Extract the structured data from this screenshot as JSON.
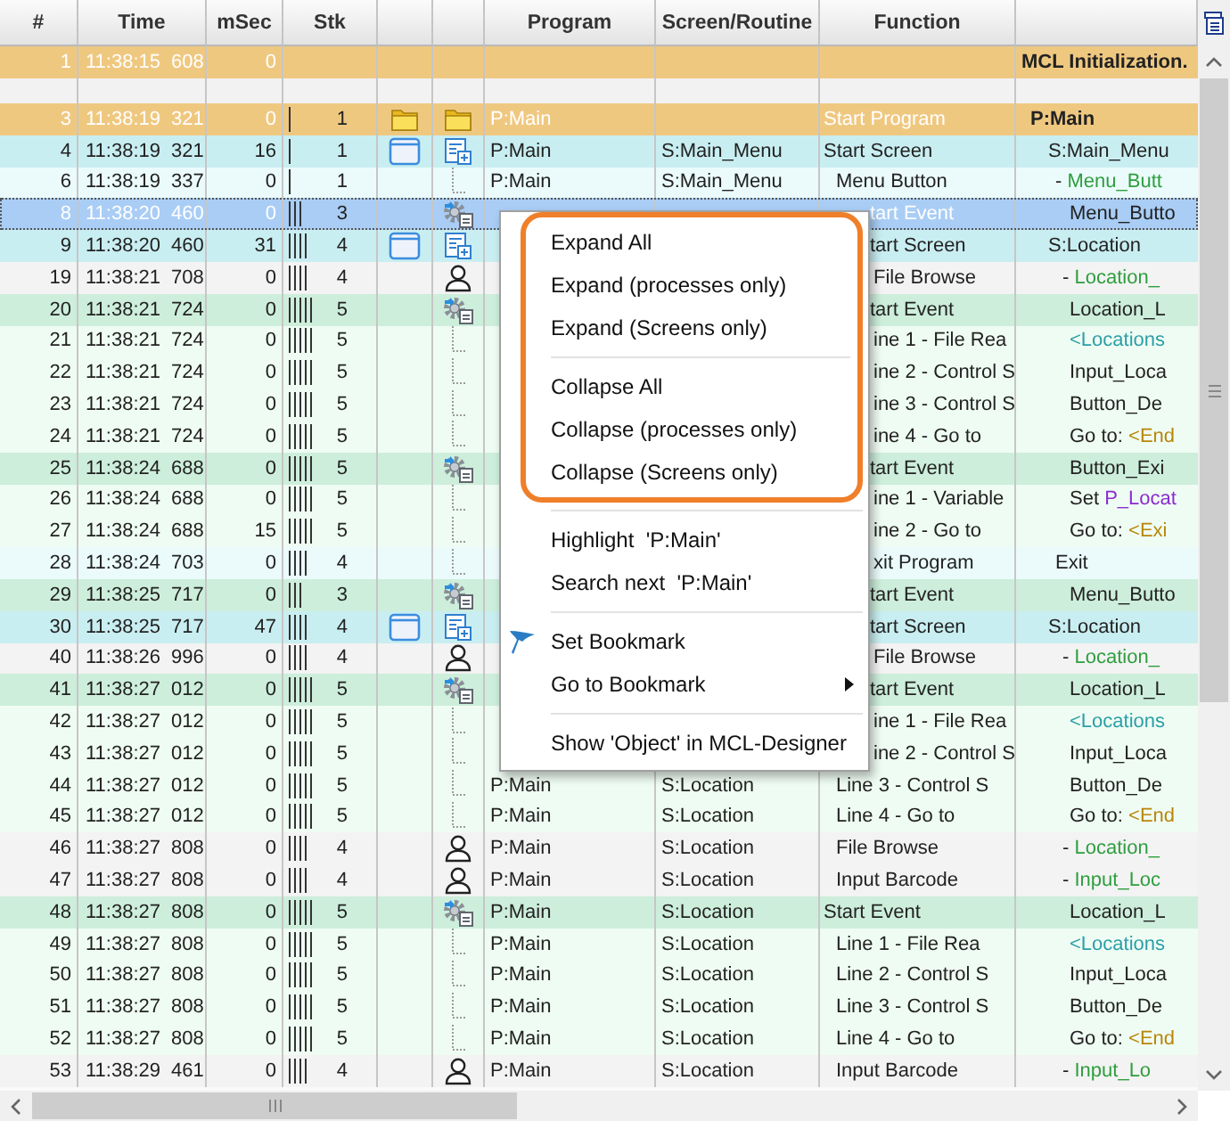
{
  "columns": [
    "#",
    "Time",
    "mSec",
    "Stk",
    "Program",
    "Screen/Routine",
    "Function"
  ],
  "rows": [
    {
      "kind": "init",
      "selected": false,
      "num": "1",
      "time": "11:38:15 608",
      "msec": "0",
      "detail": [
        {
          "text": "MCL Initialization."
        }
      ]
    },
    {
      "kind": "blank",
      "selected": false
    },
    {
      "kind": "program",
      "selected": false,
      "num": "3",
      "time": "11:38:19 321",
      "msec": "0",
      "stk": "1",
      "program": "P:Main",
      "function": "Start Program",
      "detail": [
        {
          "text": "P:Main"
        }
      ]
    },
    {
      "kind": "screen",
      "selected": false,
      "num": "4",
      "time": "11:38:19 321",
      "msec": "16",
      "stk": "1",
      "program": "P:Main",
      "screen": "S:Main_Menu",
      "function": "Start Screen",
      "detail": [
        {
          "text": "S:Main_Menu"
        }
      ]
    },
    {
      "kind": "screen_item",
      "selected": false,
      "num": "6",
      "time": "11:38:19 337",
      "msec": "0",
      "stk": "1",
      "program": "P:Main",
      "screen": "S:Main_Menu",
      "function": "Menu Button",
      "detail": [
        {
          "text": "- "
        },
        {
          "text": "Menu_Butt",
          "kind": "control"
        }
      ]
    },
    {
      "kind": "event",
      "selected": true,
      "num": "8",
      "time": "11:38:20 460",
      "msec": "0",
      "stk": "3",
      "function": "tart Event",
      "detail": [
        {
          "text": "Menu_Butto"
        }
      ]
    },
    {
      "kind": "screen",
      "selected": false,
      "num": "9",
      "time": "11:38:20 460",
      "msec": "31",
      "stk": "4",
      "function": "tart Screen",
      "detail": [
        {
          "text": "S:Location"
        }
      ]
    },
    {
      "kind": "user",
      "selected": false,
      "num": "19",
      "time": "11:38:21 708",
      "msec": "0",
      "stk": "4",
      "function": "File Browse",
      "detail": [
        {
          "text": "- "
        },
        {
          "text": "Location_",
          "kind": "control"
        }
      ]
    },
    {
      "kind": "event",
      "selected": false,
      "num": "20",
      "time": "11:38:21 724",
      "msec": "0",
      "stk": "5",
      "function": "tart Event",
      "detail": [
        {
          "text": "Location_L"
        }
      ]
    },
    {
      "kind": "line",
      "selected": false,
      "num": "21",
      "time": "11:38:21 724",
      "msec": "0",
      "stk": "5",
      "function": "ine 1 - File Rea",
      "detail": [
        {
          "text": "<Locations",
          "kind": "list"
        }
      ]
    },
    {
      "kind": "line",
      "selected": false,
      "num": "22",
      "time": "11:38:21 724",
      "msec": "0",
      "stk": "5",
      "function": "ine 2 - Control S",
      "detail": [
        {
          "text": "Input_Loca"
        }
      ]
    },
    {
      "kind": "line",
      "selected": false,
      "num": "23",
      "time": "11:38:21 724",
      "msec": "0",
      "stk": "5",
      "function": "ine 3 - Control S",
      "detail": [
        {
          "text": "Button_De"
        }
      ]
    },
    {
      "kind": "line",
      "selected": false,
      "num": "24",
      "time": "11:38:21 724",
      "msec": "0",
      "stk": "5",
      "function": "ine 4 - Go to",
      "detail": [
        {
          "text": "Go to: "
        },
        {
          "text": "<End",
          "kind": "label"
        }
      ]
    },
    {
      "kind": "event",
      "selected": false,
      "num": "25",
      "time": "11:38:24 688",
      "msec": "0",
      "stk": "5",
      "function": "tart Event",
      "detail": [
        {
          "text": "Button_Exi"
        }
      ]
    },
    {
      "kind": "line",
      "selected": false,
      "num": "26",
      "time": "11:38:24 688",
      "msec": "0",
      "stk": "5",
      "function": "ine 1 - Variable",
      "detail": [
        {
          "text": "Set "
        },
        {
          "text": "P_Locat",
          "kind": "variable"
        }
      ]
    },
    {
      "kind": "line",
      "selected": false,
      "num": "27",
      "time": "11:38:24 688",
      "msec": "15",
      "stk": "5",
      "function": "ine 2 - Go to",
      "detail": [
        {
          "text": "Go to: "
        },
        {
          "text": "<Exi",
          "kind": "label"
        }
      ]
    },
    {
      "kind": "screen_item",
      "selected": false,
      "num": "28",
      "time": "11:38:24 703",
      "msec": "0",
      "stk": "4",
      "function": "xit Program",
      "detail": [
        {
          "text": "Exit"
        }
      ]
    },
    {
      "kind": "event",
      "selected": false,
      "num": "29",
      "time": "11:38:25 717",
      "msec": "0",
      "stk": "3",
      "function": "tart Event",
      "detail": [
        {
          "text": "Menu_Butto"
        }
      ]
    },
    {
      "kind": "screen",
      "selected": false,
      "num": "30",
      "time": "11:38:25 717",
      "msec": "47",
      "stk": "4",
      "function": "tart Screen",
      "detail": [
        {
          "text": "S:Location"
        }
      ]
    },
    {
      "kind": "user",
      "selected": false,
      "num": "40",
      "time": "11:38:26 996",
      "msec": "0",
      "stk": "4",
      "function": "File Browse",
      "detail": [
        {
          "text": "- "
        },
        {
          "text": "Location_",
          "kind": "control"
        }
      ]
    },
    {
      "kind": "event",
      "selected": false,
      "num": "41",
      "time": "11:38:27 012",
      "msec": "0",
      "stk": "5",
      "function": "tart Event",
      "detail": [
        {
          "text": "Location_L"
        }
      ]
    },
    {
      "kind": "line",
      "selected": false,
      "num": "42",
      "time": "11:38:27 012",
      "msec": "0",
      "stk": "5",
      "function": "ine 1 - File Rea",
      "detail": [
        {
          "text": "<Locations",
          "kind": "list"
        }
      ]
    },
    {
      "kind": "line",
      "selected": false,
      "num": "43",
      "time": "11:38:27 012",
      "msec": "0",
      "stk": "5",
      "function": "ine 2 - Control S",
      "detail": [
        {
          "text": "Input_Loca"
        }
      ]
    },
    {
      "kind": "line",
      "selected": false,
      "num": "44",
      "time": "11:38:27 012",
      "msec": "0",
      "stk": "5",
      "program": "P:Main",
      "screen": "S:Location",
      "function": "Line 3 - Control S",
      "detail": [
        {
          "text": "Button_De"
        }
      ]
    },
    {
      "kind": "line",
      "selected": false,
      "num": "45",
      "time": "11:38:27 012",
      "msec": "0",
      "stk": "5",
      "program": "P:Main",
      "screen": "S:Location",
      "function": "Line 4 - Go to",
      "detail": [
        {
          "text": "Go to: "
        },
        {
          "text": "<End",
          "kind": "label"
        }
      ]
    },
    {
      "kind": "user",
      "selected": false,
      "num": "46",
      "time": "11:38:27 808",
      "msec": "0",
      "stk": "4",
      "program": "P:Main",
      "screen": "S:Location",
      "function": "File Browse",
      "detail": [
        {
          "text": "- "
        },
        {
          "text": "Location_",
          "kind": "control"
        }
      ]
    },
    {
      "kind": "user",
      "selected": false,
      "num": "47",
      "time": "11:38:27 808",
      "msec": "0",
      "stk": "4",
      "program": "P:Main",
      "screen": "S:Location",
      "function": "Input Barcode",
      "detail": [
        {
          "text": "- "
        },
        {
          "text": "Input_Loc",
          "kind": "control"
        }
      ]
    },
    {
      "kind": "event",
      "selected": false,
      "num": "48",
      "time": "11:38:27 808",
      "msec": "0",
      "stk": "5",
      "program": "P:Main",
      "screen": "S:Location",
      "function": "Start Event",
      "detail": [
        {
          "text": "Location_L"
        }
      ]
    },
    {
      "kind": "line",
      "selected": false,
      "num": "49",
      "time": "11:38:27 808",
      "msec": "0",
      "stk": "5",
      "program": "P:Main",
      "screen": "S:Location",
      "function": "Line 1 - File Rea",
      "detail": [
        {
          "text": "<Locations",
          "kind": "list"
        }
      ]
    },
    {
      "kind": "line",
      "selected": false,
      "num": "50",
      "time": "11:38:27 808",
      "msec": "0",
      "stk": "5",
      "program": "P:Main",
      "screen": "S:Location",
      "function": "Line 2 - Control S",
      "detail": [
        {
          "text": "Input_Loca"
        }
      ]
    },
    {
      "kind": "line",
      "selected": false,
      "num": "51",
      "time": "11:38:27 808",
      "msec": "0",
      "stk": "5",
      "program": "P:Main",
      "screen": "S:Location",
      "function": "Line 3 - Control S",
      "detail": [
        {
          "text": "Button_De"
        }
      ]
    },
    {
      "kind": "line",
      "selected": false,
      "num": "52",
      "time": "11:38:27 808",
      "msec": "0",
      "stk": "5",
      "program": "P:Main",
      "screen": "S:Location",
      "function": "Line 4 - Go to",
      "detail": [
        {
          "text": "Go to: "
        },
        {
          "text": "<End",
          "kind": "label"
        }
      ]
    },
    {
      "kind": "user",
      "selected": false,
      "num": "53",
      "time": "11:38:29 461",
      "msec": "0",
      "stk": "4",
      "program": "P:Main",
      "screen": "S:Location",
      "function": "Input Barcode",
      "detail": [
        {
          "text": "- "
        },
        {
          "text": "Input_Lo",
          "kind": "control"
        }
      ]
    }
  ],
  "context_menu": {
    "sections": [
      {
        "framed": true,
        "groups": [
          [
            {
              "label": "Expand All",
              "kind": "plain"
            },
            {
              "label": "Expand (processes only)",
              "kind": "plain"
            },
            {
              "label": "Expand (Screens only)",
              "kind": "plain"
            }
          ],
          [
            {
              "label": "Collapse All",
              "kind": "plain"
            },
            {
              "label": "Collapse (processes only)",
              "kind": "plain"
            },
            {
              "label": "Collapse (Screens only)",
              "kind": "plain"
            }
          ]
        ]
      },
      {
        "framed": false,
        "groups": [
          [
            {
              "label": "Highlight  'P:Main'",
              "kind": "plain"
            },
            {
              "label": "Search next  'P:Main'",
              "kind": "plain"
            }
          ],
          [
            {
              "label": "Set Bookmark",
              "kind": "flagged"
            },
            {
              "label": "Go to Bookmark",
              "kind": "submenu"
            }
          ],
          [
            {
              "label": "Show 'Object' in MCL-Designer",
              "kind": "plain"
            }
          ]
        ]
      }
    ]
  }
}
